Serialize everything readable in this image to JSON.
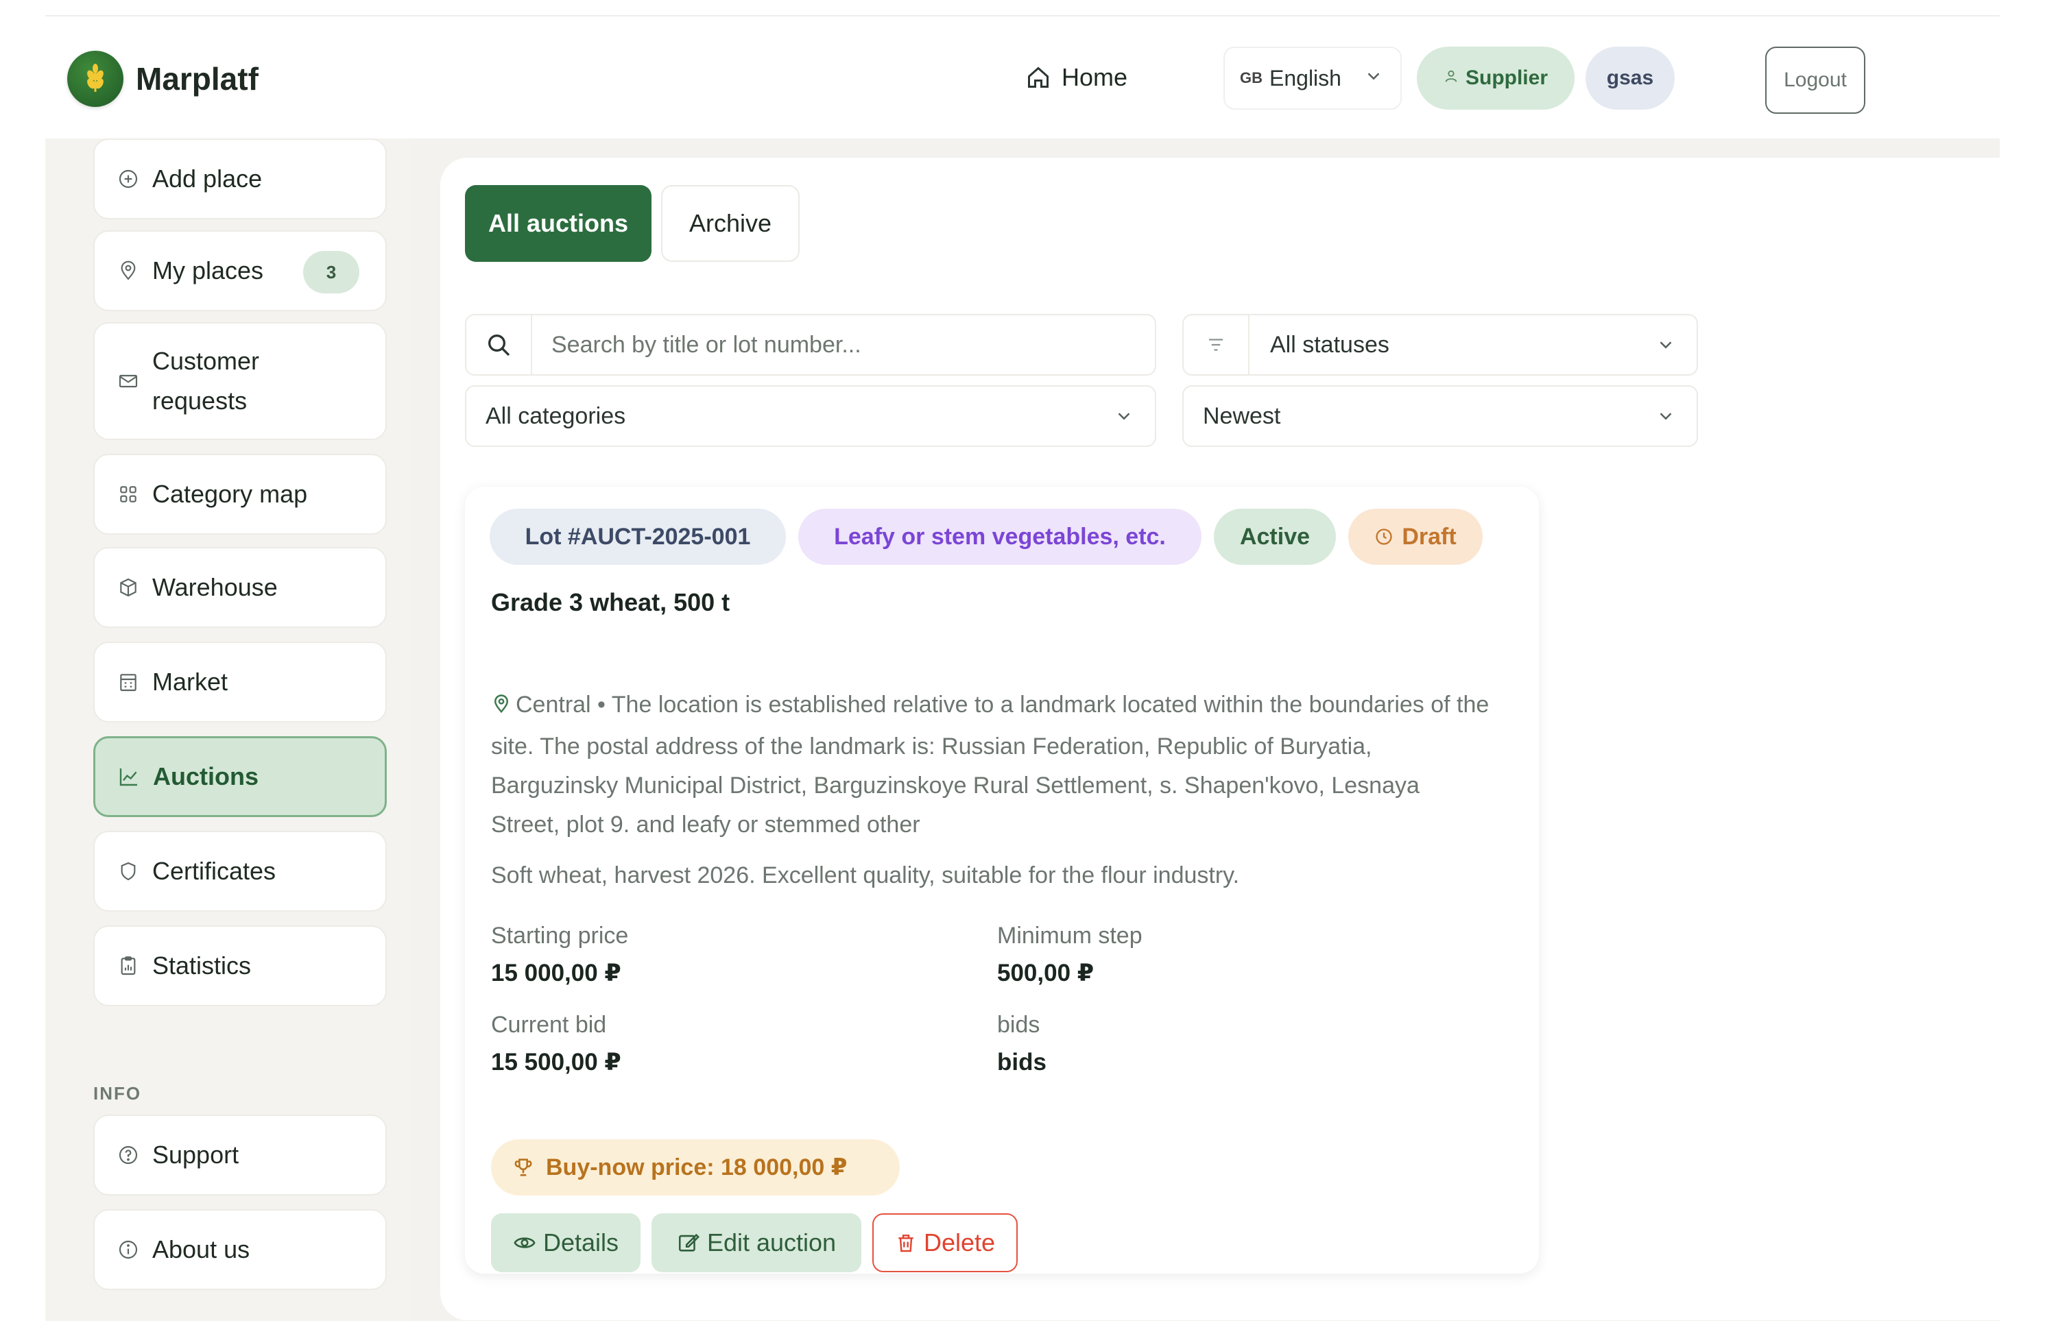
{
  "brand": {
    "name": "Marplatf",
    "logo_icon": "wheat-logo-icon"
  },
  "header": {
    "home_label": "Home",
    "language": {
      "flag": "GB",
      "label": "English"
    },
    "role_label": "Supplier",
    "user_label": "gsas",
    "logout_label": "Logout"
  },
  "sidebar": {
    "items": [
      {
        "label": "Add place",
        "icon": "plus-circle-icon"
      },
      {
        "label": "My places",
        "icon": "map-pin-icon",
        "count": "3"
      },
      {
        "label_line1": "Customer",
        "label_line2": "requests",
        "icon": "mail-icon"
      },
      {
        "label": "Category map",
        "icon": "grid-icon"
      },
      {
        "label": "Warehouse",
        "icon": "box-icon"
      },
      {
        "label": "Market",
        "icon": "store-icon"
      },
      {
        "label": "Auctions",
        "icon": "chart-line-icon",
        "active": true
      },
      {
        "label": "Certificates",
        "icon": "shield-icon"
      },
      {
        "label": "Statistics",
        "icon": "clipboard-chart-icon"
      }
    ],
    "info_heading": "INFO",
    "info_items": [
      {
        "label": "Support",
        "icon": "help-circle-icon"
      },
      {
        "label": "About us",
        "icon": "info-circle-icon"
      }
    ]
  },
  "tabs": [
    {
      "label": "All auctions",
      "active": true
    },
    {
      "label": "Archive",
      "active": false
    }
  ],
  "filters": {
    "search_placeholder": "Search by title or lot number...",
    "status_value": "All statuses",
    "category_value": "All categories",
    "sort_value": "Newest"
  },
  "auction": {
    "lot": "Lot #AUCT-2025-001",
    "category": "Leafy or stem vegetables, etc.",
    "status": "Active",
    "state": "Draft",
    "title": "Grade 3 wheat, 500 t",
    "location": "Central • The location is established relative to a landmark located within the boundaries of the site. The postal address of the landmark is: Russian Federation, Republic of Buryatia, Barguzinsky Municipal District, Barguzinskoye Rural Settlement, s. Shapen'kovo, Lesnaya Street, plot 9. and leafy or stemmed other",
    "description": "Soft wheat, harvest 2026. Excellent quality, suitable for the flour industry.",
    "starting_price_label": "Starting price",
    "starting_price": "15 000,00 ₽",
    "min_step_label": "Minimum step",
    "min_step": "500,00 ₽",
    "current_bid_label": "Current bid",
    "current_bid": "15 500,00 ₽",
    "bids_label": "bids",
    "bids_value": "bids",
    "buy_now": "Buy-now price: 18 000,00 ₽",
    "details_label": "Details",
    "edit_label": "Edit auction",
    "delete_label": "Delete"
  },
  "colors": {
    "primary": "#2c6d3f",
    "primary_light": "#d8eadb",
    "category_chip": "#7b45d6",
    "draft_chip": "#c2762d",
    "danger": "#e0432f"
  }
}
